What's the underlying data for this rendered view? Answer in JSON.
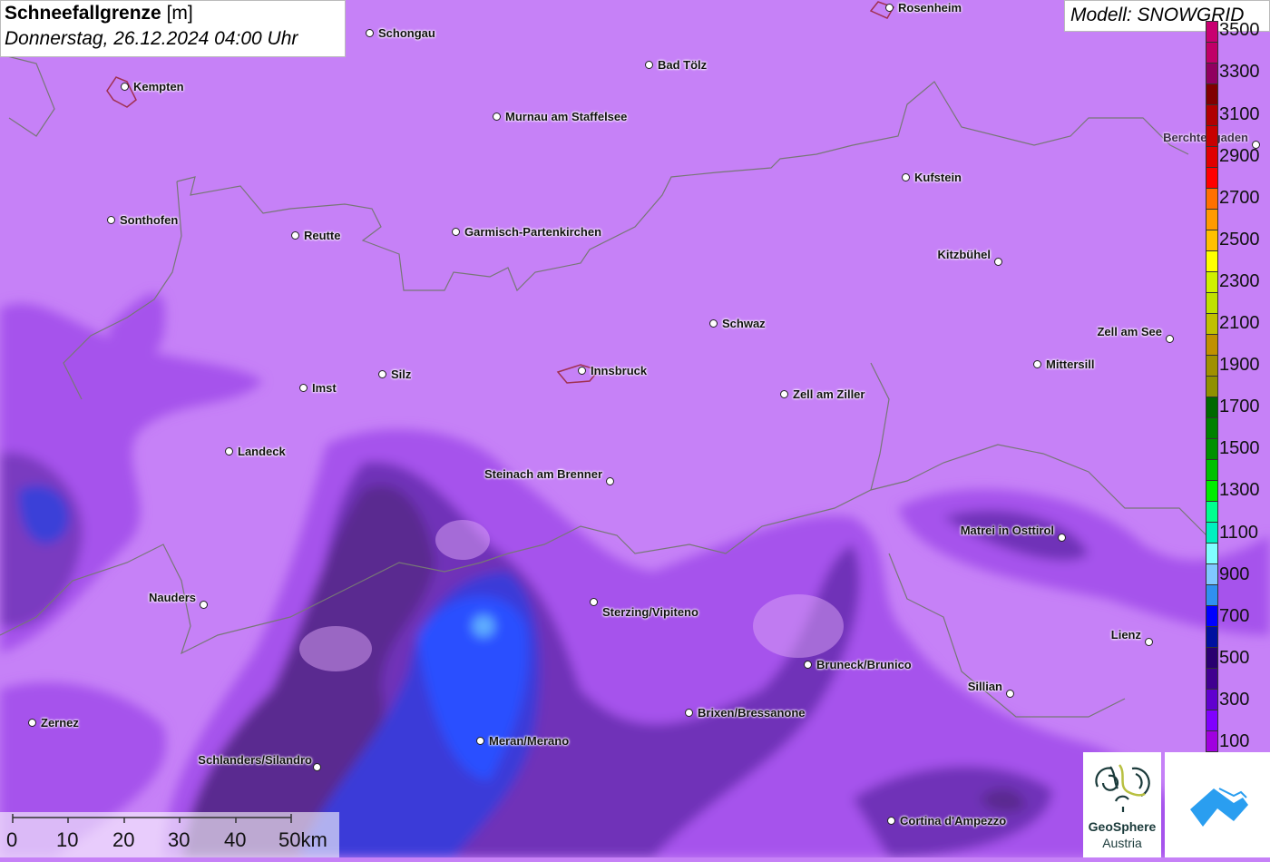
{
  "title": {
    "parameter": "Schneefallgrenze",
    "unit": "[m]",
    "datetime": "Donnerstag, 26.12.2024 04:00 Uhr"
  },
  "model": "Modell: SNOWGRID",
  "legend": {
    "labels": [
      "3500",
      "3300",
      "3100",
      "2900",
      "2700",
      "2500",
      "2300",
      "2100",
      "1900",
      "1700",
      "1500",
      "1300",
      "1100",
      "900",
      "700",
      "500",
      "300",
      "100"
    ],
    "colors_top_to_bottom": [
      "#d0007a",
      "#c80070",
      "#c00068",
      "#900060",
      "#800000",
      "#b00000",
      "#c80000",
      "#e00000",
      "#ff0000",
      "#ff7000",
      "#ff9a00",
      "#ffc000",
      "#ffff00",
      "#d0f000",
      "#c0e000",
      "#c0c000",
      "#c09000",
      "#a09000",
      "#909000",
      "#006800",
      "#008000",
      "#009000",
      "#00c000",
      "#00ee00",
      "#00ff90",
      "#00f0c0",
      "#80ffff",
      "#80c8ff",
      "#3090f0",
      "#0000ff",
      "#0010a0",
      "#2a0070",
      "#400090",
      "#6000d0",
      "#8000ff",
      "#a000e0",
      "#b860f0"
    ]
  },
  "cities": [
    "Rosenheim",
    "Schongau",
    "Bad Tölz",
    "Kempten",
    "Murnau am Staffelsee",
    "Berchtesgaden",
    "Kufstein",
    "Sonthofen",
    "Reutte",
    "Garmisch-Partenkirchen",
    "Kitzbühel",
    "Schwaz",
    "Zell am See",
    "Mittersill",
    "Imst",
    "Silz",
    "Innsbruck",
    "Zell am Ziller",
    "Landeck",
    "Steinach am Brenner",
    "Matrei in Osttirol",
    "Nauders",
    "Sterzing/Vipiteno",
    "Lienz",
    "Bruneck/Brunico",
    "Sillian",
    "Brixen/Bressanone",
    "Zernez",
    "Meran/Merano",
    "Schlanders/Silandro",
    "Cortina d'Ampezzo"
  ],
  "scale": {
    "ticks": [
      "0",
      "10",
      "20",
      "30",
      "40",
      "50km"
    ]
  },
  "logos": {
    "geosphere_line1": "GeoSphere",
    "geosphere_line2": "Austria"
  }
}
